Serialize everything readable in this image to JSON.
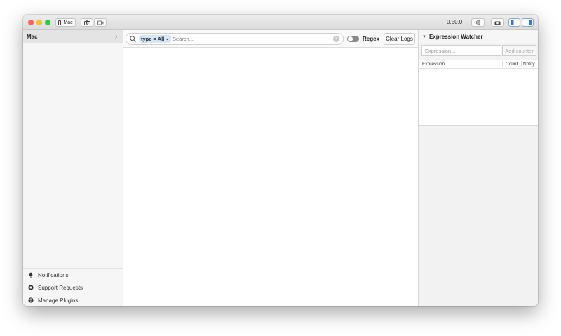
{
  "titlebar": {
    "device_button_label": "Mac",
    "version": "0.50.0",
    "colors": {
      "close": "#fe5f57",
      "minimize": "#febc2e",
      "zoom": "#28c840"
    }
  },
  "sidebar": {
    "device_name": "Mac",
    "bottom_items": [
      {
        "label": "Notifications",
        "icon": "bell-icon"
      },
      {
        "label": "Support Requests",
        "icon": "support-icon"
      },
      {
        "label": "Manage Plugins",
        "icon": "help-icon"
      }
    ]
  },
  "toolbar": {
    "filter_token": "type = All",
    "search_placeholder": "Search...",
    "regex_label": "Regex",
    "clear_logs_label": "Clear Logs"
  },
  "expression_watcher": {
    "title": "Expression Watcher",
    "input_placeholder": "Expression...",
    "add_button_label": "Add counter",
    "columns": [
      "Expression",
      "Count",
      "Notify"
    ]
  }
}
